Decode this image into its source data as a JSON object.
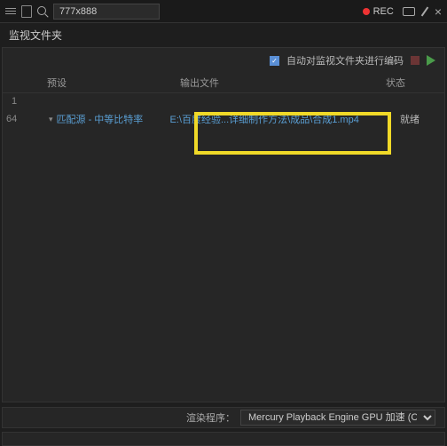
{
  "titlebar": {
    "search_value": "777x888",
    "rec_label": "REC"
  },
  "panel": {
    "title": "监视文件夹",
    "auto_label": "自动对监视文件夹进行编码"
  },
  "headers": {
    "preset": "预设",
    "output": "输出文件",
    "status": "状态"
  },
  "subhead": "1",
  "row": {
    "format": "64",
    "preset": "匹配源 - 中等比特率",
    "output": "E:\\百度经验...详细制作方法\\成品\\合成1.mp4",
    "status": "就绪"
  },
  "footer": {
    "label": "渲染程序：",
    "renderer": "Mercury Playback Engine GPU 加速 (CUDA)"
  }
}
